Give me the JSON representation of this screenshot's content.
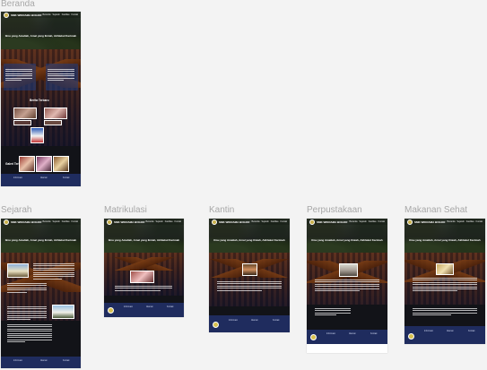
{
  "canvas": {
    "background": "#f3f3f3"
  },
  "frames": {
    "beranda": {
      "label": "Beranda"
    },
    "sejarah": {
      "label": "Sejarah"
    },
    "matrikulasi": {
      "label": "Matrikulasi"
    },
    "kantin": {
      "label": "Kantin"
    },
    "perpustakaan": {
      "label": "Perpustakaan"
    },
    "makanan_sehat": {
      "label": "Makanan Sehat"
    }
  },
  "site": {
    "school_name": "SMK WIKRAMA BOGOR",
    "nav_links": [
      "Beranda",
      "Sejarah",
      "Fasilitas",
      "Kontak"
    ],
    "tagline": "Ilmu yang Amaliah, Amal yang Ilmiah, Akhlakul Karimah",
    "section_berita": "Berita Terbaru",
    "section_galeri": "Galeri Terbaru",
    "footer_cols": [
      "Informasi",
      "Alamat",
      "Kontak"
    ]
  },
  "colors": {
    "footer": "#1f2c5e",
    "dark_band": "#121318",
    "panel": "#1e3c82"
  },
  "icons": [
    "logo-crest-icon"
  ]
}
